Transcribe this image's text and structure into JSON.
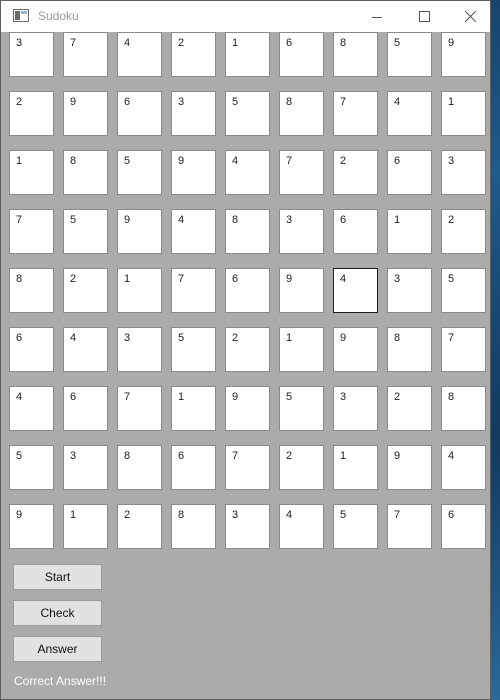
{
  "window": {
    "title": "Sudoku",
    "controls": {
      "minimize_icon": "minimize-icon",
      "maximize_icon": "maximize-icon",
      "close_icon": "close-icon"
    }
  },
  "grid": {
    "rows": [
      [
        "3",
        "7",
        "4",
        "2",
        "1",
        "6",
        "8",
        "5",
        "9"
      ],
      [
        "2",
        "9",
        "6",
        "3",
        "5",
        "8",
        "7",
        "4",
        "1"
      ],
      [
        "1",
        "8",
        "5",
        "9",
        "4",
        "7",
        "2",
        "6",
        "3"
      ],
      [
        "7",
        "5",
        "9",
        "4",
        "8",
        "3",
        "6",
        "1",
        "2"
      ],
      [
        "8",
        "2",
        "1",
        "7",
        "6",
        "9",
        "4",
        "3",
        "5"
      ],
      [
        "6",
        "4",
        "3",
        "5",
        "2",
        "1",
        "9",
        "8",
        "7"
      ],
      [
        "4",
        "6",
        "7",
        "1",
        "9",
        "5",
        "3",
        "2",
        "8"
      ],
      [
        "5",
        "3",
        "8",
        "6",
        "7",
        "2",
        "1",
        "9",
        "4"
      ],
      [
        "9",
        "1",
        "2",
        "8",
        "3",
        "4",
        "5",
        "7",
        "6"
      ]
    ],
    "focused_cell": {
      "row": 4,
      "col": 6
    }
  },
  "buttons": {
    "start_label": "Start",
    "check_label": "Check",
    "answer_label": "Answer"
  },
  "status_text": "Correct Answer!!!"
}
